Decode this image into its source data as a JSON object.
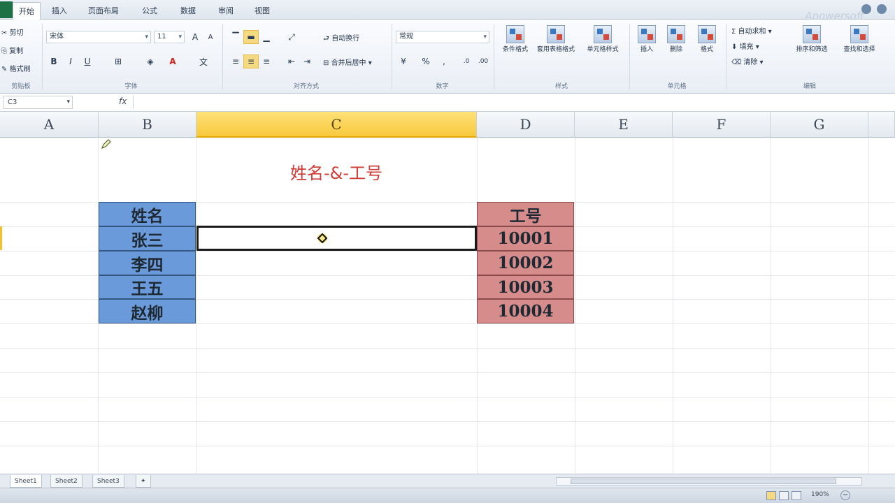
{
  "tabs": [
    "开始",
    "插入",
    "页面布局",
    "公式",
    "数据",
    "审阅",
    "视图"
  ],
  "active_tab": "开始",
  "watermark": "Apowersoft",
  "ribbon": {
    "clipboard": {
      "cut": "剪切",
      "copy": "复制",
      "format_painter": "格式刷",
      "label": "剪贴板"
    },
    "font": {
      "name": "宋体",
      "size": "11",
      "label": "字体"
    },
    "alignment": {
      "wrap": "自动换行",
      "merge": "合并后居中",
      "label": "对齐方式"
    },
    "number": {
      "format": "常规",
      "label": "数字"
    },
    "styles": {
      "conditional": "条件格式",
      "table": "套用表格格式",
      "cell_styles": "单元格样式",
      "label": "样式"
    },
    "cells": {
      "insert": "插入",
      "delete": "删除",
      "format": "格式",
      "label": "单元格"
    },
    "editing": {
      "autosum": "自动求和",
      "fill": "填充",
      "clear": "清除",
      "sort": "排序和筛选",
      "find": "查找和选择",
      "label": "编辑"
    }
  },
  "formula_bar": {
    "name_box": "C3",
    "fx": "fx",
    "content": ""
  },
  "columns": [
    "A",
    "B",
    "C",
    "D",
    "E",
    "F",
    "G"
  ],
  "active_column": "C",
  "sheet": {
    "title": "姓名-&-工号",
    "names_header": "姓名",
    "names": [
      "张三",
      "李四",
      "王五",
      "赵柳"
    ],
    "ids_header": "工号",
    "ids": [
      "10001",
      "10002",
      "10003",
      "10004"
    ]
  },
  "sheet_tabs": [
    "Sheet1",
    "Sheet2",
    "Sheet3"
  ],
  "status": {
    "zoom": "190%"
  },
  "colors": {
    "accent_header": "#f7c83c",
    "blue_cells": "#6a9ad9",
    "red_cells": "#d78c8c",
    "title_text": "#d23a35"
  }
}
